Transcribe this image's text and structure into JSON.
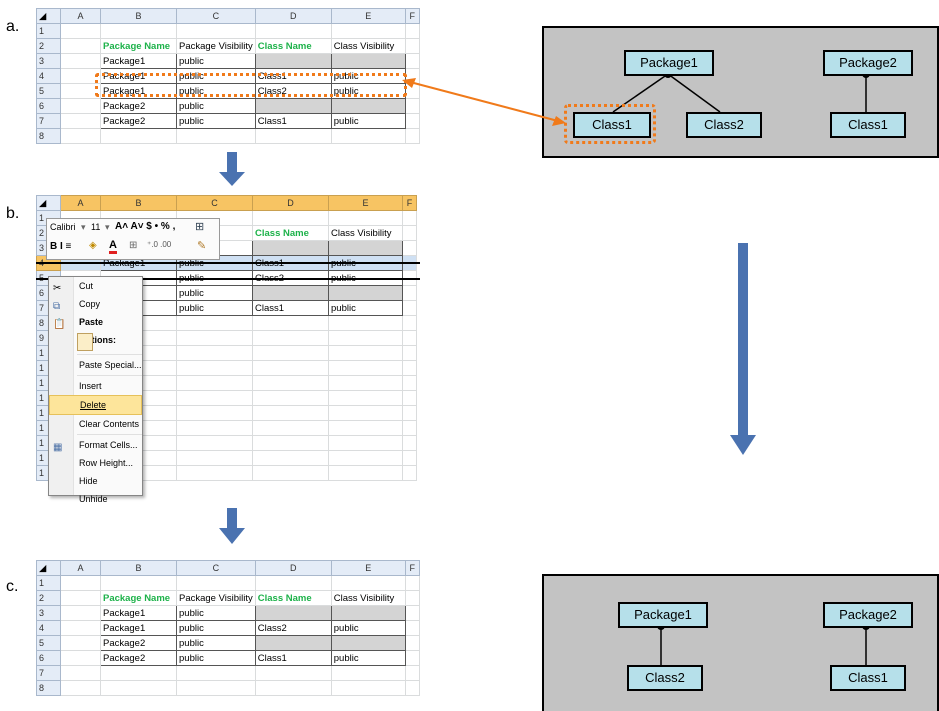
{
  "steps": {
    "a": "a.",
    "b": "b.",
    "c": "c."
  },
  "columns": [
    "A",
    "B",
    "C",
    "D",
    "E",
    "F"
  ],
  "sheet_a": {
    "header": [
      "Package Name",
      "Package Visibility",
      "Class Name",
      "Class Visibility"
    ],
    "rows": [
      [
        "Package1",
        "public",
        "",
        ""
      ],
      [
        "Package1",
        "public",
        "Class1",
        "public"
      ],
      [
        "Package1",
        "public",
        "Class2",
        "public"
      ],
      [
        "Package2",
        "public",
        "",
        ""
      ],
      [
        "Package2",
        "public",
        "Class1",
        "public"
      ]
    ]
  },
  "sheet_b": {
    "header_partial": "isibility",
    "header": [
      "Class Name",
      "Class Visibility"
    ],
    "rows": [
      [
        "Package1",
        "public",
        "Class1",
        "public"
      ],
      [
        "",
        "public",
        "Class2",
        "public"
      ],
      [
        "",
        "public",
        "",
        ""
      ],
      [
        "",
        "public",
        "Class1",
        "public"
      ]
    ],
    "row_numbers": [
      "1",
      "2",
      "3",
      "4",
      "5",
      "6",
      "7",
      "8",
      "9",
      "1",
      "1",
      "1",
      "1",
      "1",
      "1",
      "1",
      "1",
      "1"
    ]
  },
  "mini_toolbar": {
    "font": "Calibri",
    "size": "11",
    "row1_glyphs": "A˄ A˅ $ • % ,",
    "row2_glyphs": "B I ≡"
  },
  "context_menu": {
    "items": [
      "Cut",
      "Copy",
      "Paste Options:",
      "Paste Special...",
      "Insert",
      "Delete",
      "Clear Contents",
      "Format Cells...",
      "Row Height...",
      "Hide",
      "Unhide"
    ]
  },
  "sheet_c": {
    "header": [
      "Package Name",
      "Package Visibility",
      "Class Name",
      "Class Visibility"
    ],
    "rows": [
      [
        "Package1",
        "public",
        "",
        ""
      ],
      [
        "Package1",
        "public",
        "Class2",
        "public"
      ],
      [
        "Package2",
        "public",
        "",
        ""
      ],
      [
        "Package2",
        "public",
        "Class1",
        "public"
      ]
    ]
  },
  "diagram_top": {
    "nodes": [
      "Package1",
      "Package2",
      "Class1",
      "Class2",
      "Class1"
    ]
  },
  "diagram_bottom": {
    "nodes": [
      "Package1",
      "Package2",
      "Class2",
      "Class1"
    ]
  },
  "colors": {
    "highlight": "#f07a1a",
    "arrow": "#4a72b0",
    "node": "#b6e0ea",
    "panel": "#c3c3c3"
  }
}
